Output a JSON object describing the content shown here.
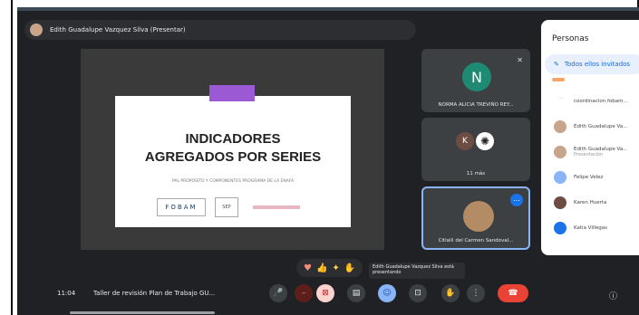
{
  "presenter": {
    "name": "Edith Guadalupe Vazquez Silva (Presentar)"
  },
  "slide": {
    "title_line1": "INDICADORES",
    "title_line2": "AGREGADOS POR SERIES",
    "subtitle": "PAL PROPOSITO Y COMPONENTES PROGRAMA DE LA ENAFA",
    "logo1": "FOBAM",
    "logo2": "SEP"
  },
  "tiles": {
    "t1": {
      "initial": "N",
      "name": "NORMA ALICIA TREVIÑO REY..."
    },
    "t2": {
      "initial": "K",
      "label": "11 más"
    },
    "t3": {
      "name": "Citlalli del Carmen Sandoval..."
    }
  },
  "people": {
    "title": "Personas",
    "tab": "Todos ellos invitados",
    "items": [
      {
        "name": "coordinacion.fobam..."
      },
      {
        "name": "Edith Guadalupe Va..."
      },
      {
        "name": "Edith Guadalupe Va...",
        "sub": "Presentación"
      },
      {
        "name": "Felipe Velez"
      },
      {
        "name": "Karen Huerta"
      },
      {
        "name": "Katia Villegas"
      }
    ]
  },
  "tooltip": "Edith Guadalupe Vazquez Silva está presentando",
  "bottombar": {
    "time": "11:04",
    "meeting": "Taller de revisión Plan de Trabajo GU..."
  },
  "colors": {
    "accent": "#1a73e8",
    "danger": "#ea4335",
    "bg": "#202124"
  }
}
